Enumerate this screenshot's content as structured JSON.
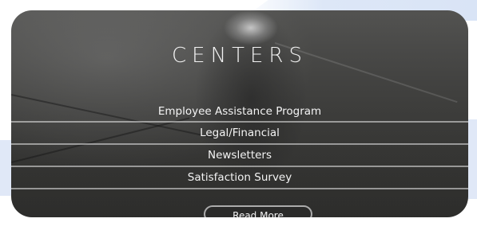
{
  "centers": {
    "title": "CENTERS",
    "items": [
      {
        "label": "Employee Assistance Program"
      },
      {
        "label": "Legal/Financial"
      },
      {
        "label": "Newsletters"
      },
      {
        "label": "Satisfaction Survey"
      }
    ],
    "read_more_label": "Read More"
  },
  "colors": {
    "card_background": "#4a4a48",
    "text": "#f2f2f2",
    "accent_background": "#dde7f7"
  }
}
